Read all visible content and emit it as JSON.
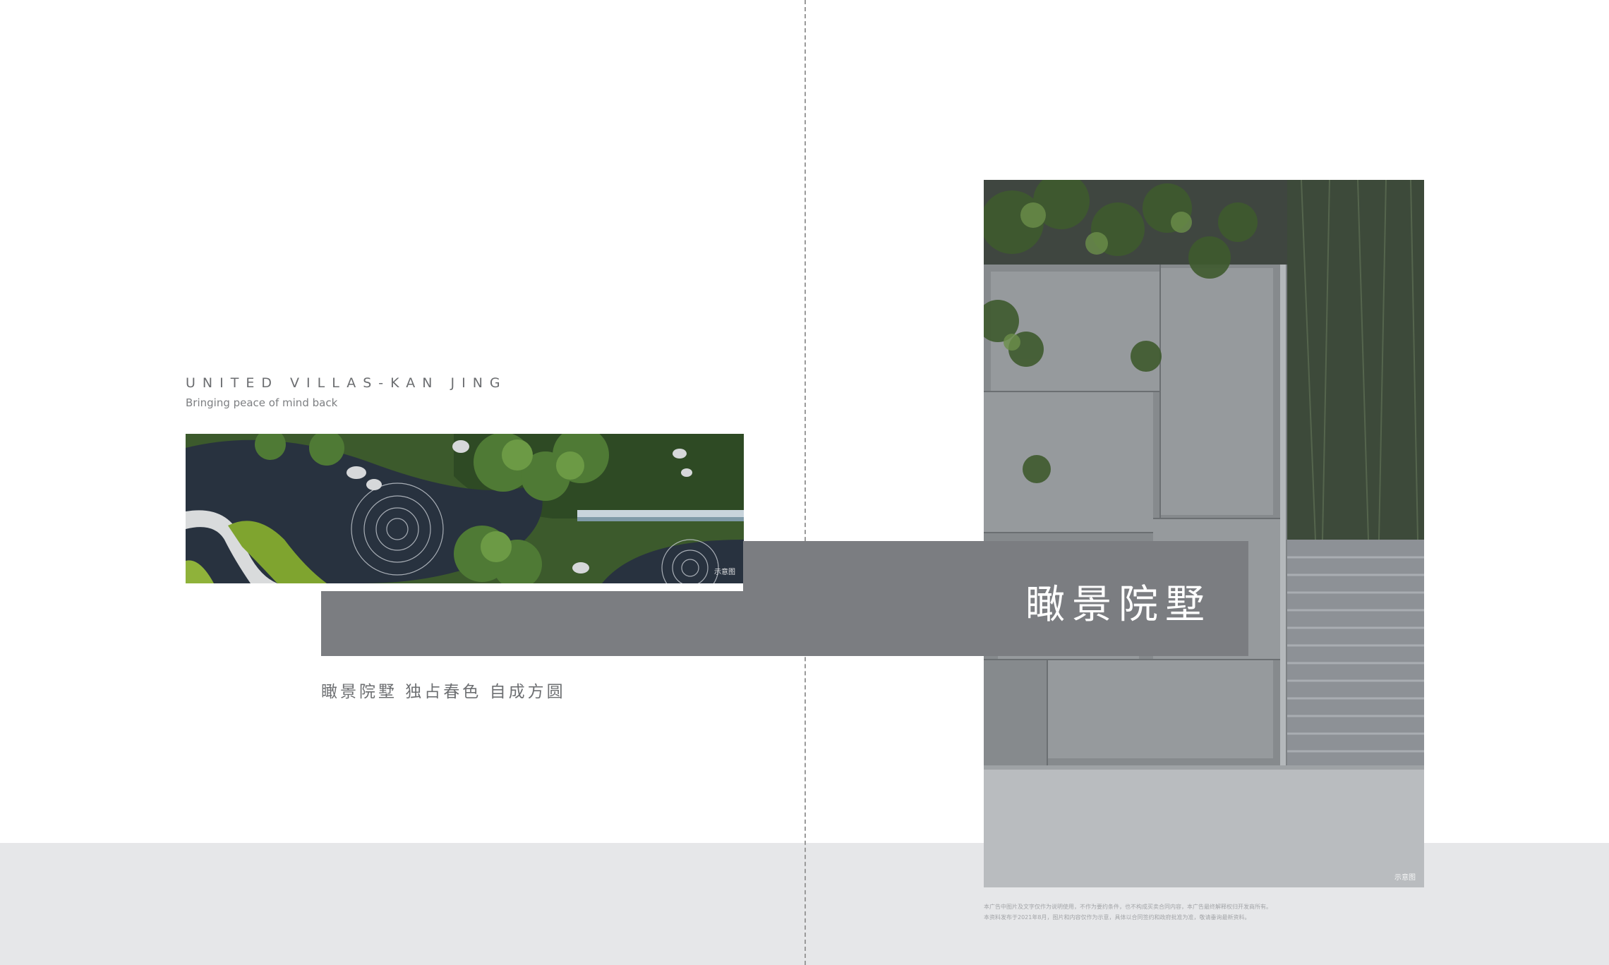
{
  "brand": {
    "title": "UNITED VILLAS-KAN JING",
    "tagline": "Bringing peace of mind back"
  },
  "banner": {
    "title": "瞰景院墅"
  },
  "slogan": "瞰景院墅 独占春色 自成方圆",
  "photos": {
    "garden_caption": "示意图",
    "wall_caption": "示意图"
  },
  "disclaimer": {
    "line1": "本广告中图片及文字仅作为说明使用，不作为要约条件，也不构成买卖合同内容，本广告最终解释权归开发商所有。",
    "line2": "本资料发布于2021年8月，图片和内容仅作为示意，具体以合同签约和政府批准为准，敬请垂询最新资料。"
  },
  "colors": {
    "band": "#7b7d81",
    "bottom_band": "#e6e7e9",
    "text_gray": "#6b6d70"
  }
}
